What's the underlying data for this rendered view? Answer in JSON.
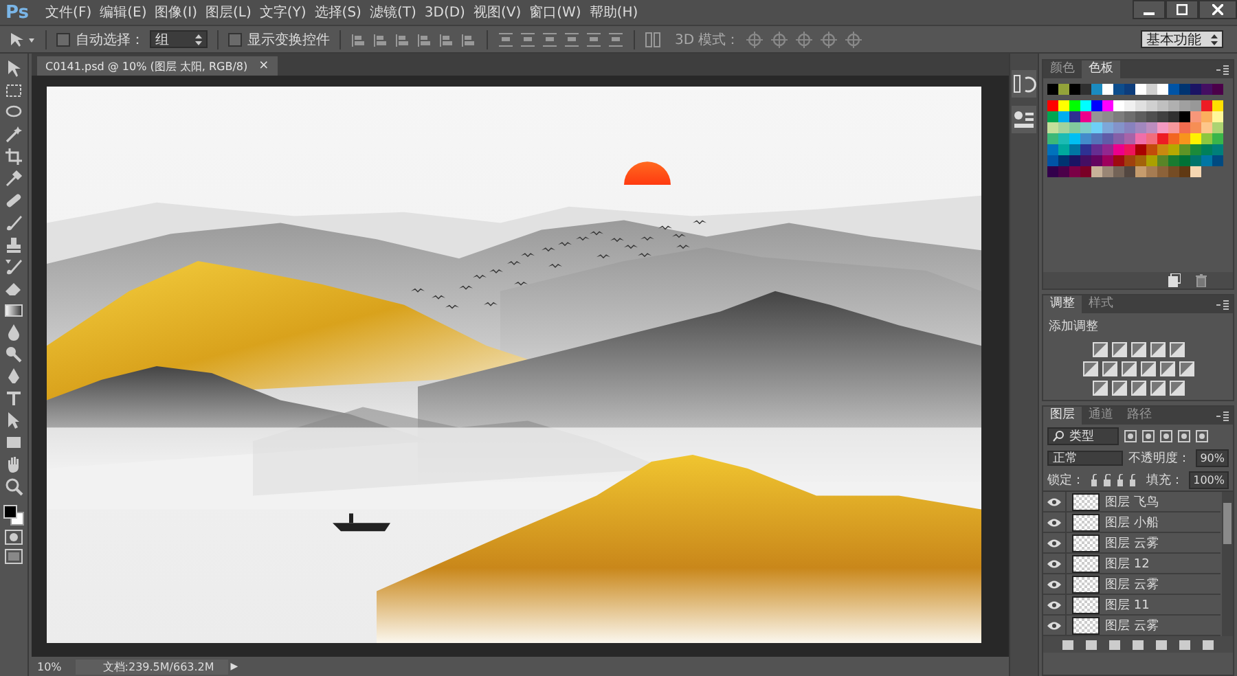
{
  "app_logo": "Ps",
  "menu": [
    "文件(F)",
    "编辑(E)",
    "图像(I)",
    "图层(L)",
    "文字(Y)",
    "选择(S)",
    "滤镜(T)",
    "3D(D)",
    "视图(V)",
    "窗口(W)",
    "帮助(H)"
  ],
  "options_bar": {
    "auto_select": {
      "label": "自动选择：",
      "checked": false
    },
    "auto_select_target": "组",
    "show_transform": {
      "label": "显示变换控件",
      "checked": false
    },
    "mode_3d_label": "3D 模式："
  },
  "workspace": "基本功能",
  "document_tab": {
    "title": "C0141.psd @ 10% (图层 太阳, RGB/8)",
    "close": "×"
  },
  "color_panel": {
    "tabs": [
      {
        "label": "颜色",
        "selected": false
      },
      {
        "label": "色板",
        "selected": true
      }
    ],
    "recent_swatches": [
      {
        "color": "#000000"
      },
      {
        "color": "#93a33a"
      },
      {
        "color": "#000000"
      },
      {
        "color": "#303030"
      },
      {
        "color": "#1b8bc0"
      },
      {
        "color": "#ffffff"
      },
      {
        "color": "#0d4d8c"
      },
      {
        "color": "#0d3d7c"
      },
      {
        "color": "#ffffff"
      },
      {
        "color": "#d0d0d0"
      },
      {
        "color": "#ffffff"
      },
      {
        "color": "#0054a6"
      },
      {
        "color": "#003471"
      },
      {
        "color": "#1b1464"
      },
      {
        "color": "#440e62"
      },
      {
        "color": "#4b0049"
      }
    ],
    "swatches": [
      [
        {
          "color": "#ff0000"
        },
        {
          "color": "#ffff00"
        },
        {
          "color": "#00ff00"
        },
        {
          "color": "#00ffff"
        },
        {
          "color": "#0000ff"
        },
        {
          "color": "#ff00ff"
        },
        {
          "color": "#ffffff"
        },
        {
          "color": "#f0f0f0"
        },
        {
          "color": "#e0e0e0"
        },
        {
          "color": "#d0d0d0"
        },
        {
          "color": "#c0c0c0"
        },
        {
          "color": "#b0b0b0"
        },
        {
          "color": "#a0a0a0"
        },
        {
          "color": "#989898"
        },
        {
          "color": "#ee1c24"
        },
        {
          "color": "#ffe000"
        }
      ],
      [
        {
          "color": "#00a651"
        },
        {
          "color": "#00aeef"
        },
        {
          "color": "#2e3192"
        },
        {
          "color": "#ec008c"
        },
        {
          "color": "#959595"
        },
        {
          "color": "#8c8c8c"
        },
        {
          "color": "#7d7d7d"
        },
        {
          "color": "#6e6e6e"
        },
        {
          "color": "#5e5e5e"
        },
        {
          "color": "#4f4f4f"
        },
        {
          "color": "#404040"
        },
        {
          "color": "#303030"
        },
        {
          "color": "#000000"
        },
        {
          "color": "#f7977a"
        },
        {
          "color": "#fbaf5d"
        },
        {
          "color": "#fff79a"
        }
      ],
      [
        {
          "color": "#c4df9b"
        },
        {
          "color": "#a3d39c"
        },
        {
          "color": "#82ca9d"
        },
        {
          "color": "#7bcdc8"
        },
        {
          "color": "#6ecff6"
        },
        {
          "color": "#7ea7d8"
        },
        {
          "color": "#8493ca"
        },
        {
          "color": "#8882be"
        },
        {
          "color": "#a187be"
        },
        {
          "color": "#bc8dbf"
        },
        {
          "color": "#f49ac2"
        },
        {
          "color": "#f6989d"
        },
        {
          "color": "#f26c4f"
        },
        {
          "color": "#f68e55"
        },
        {
          "color": "#fdc68a"
        },
        {
          "color": "#acd372"
        }
      ],
      [
        {
          "color": "#3cb878"
        },
        {
          "color": "#1cbbb4"
        },
        {
          "color": "#00bff3"
        },
        {
          "color": "#438ccb"
        },
        {
          "color": "#5574b9"
        },
        {
          "color": "#605ca8"
        },
        {
          "color": "#855fa8"
        },
        {
          "color": "#a763a8"
        },
        {
          "color": "#f06ea9"
        },
        {
          "color": "#f26d7d"
        },
        {
          "color": "#ed1c24"
        },
        {
          "color": "#f26522"
        },
        {
          "color": "#f7941d"
        },
        {
          "color": "#fff200"
        },
        {
          "color": "#8dc73f"
        },
        {
          "color": "#39b54a"
        }
      ],
      [
        {
          "color": "#0072bc"
        },
        {
          "color": "#00a99d"
        },
        {
          "color": "#0076a3"
        },
        {
          "color": "#2e3192"
        },
        {
          "color": "#662d91"
        },
        {
          "color": "#92278f"
        },
        {
          "color": "#ec008c"
        },
        {
          "color": "#ed145b"
        },
        {
          "color": "#aa0000"
        },
        {
          "color": "#c24b0a"
        },
        {
          "color": "#c98910"
        },
        {
          "color": "#b5a900"
        },
        {
          "color": "#5e9426"
        },
        {
          "color": "#1b8a3a"
        },
        {
          "color": "#00805a"
        },
        {
          "color": "#007f7a"
        }
      ],
      [
        {
          "color": "#0054a6"
        },
        {
          "color": "#003471"
        },
        {
          "color": "#1b1464"
        },
        {
          "color": "#440e62"
        },
        {
          "color": "#630460"
        },
        {
          "color": "#9e005d"
        },
        {
          "color": "#9e0b0f"
        },
        {
          "color": "#a0410d"
        },
        {
          "color": "#a36209"
        },
        {
          "color": "#aba000"
        },
        {
          "color": "#598527"
        },
        {
          "color": "#197b30"
        },
        {
          "color": "#007236"
        },
        {
          "color": "#00746b"
        },
        {
          "color": "#0076a3"
        },
        {
          "color": "#004a80"
        }
      ],
      [
        {
          "color": "#32004b"
        },
        {
          "color": "#4b0049"
        },
        {
          "color": "#7b0046"
        },
        {
          "color": "#7a0026"
        },
        {
          "color": "#c7b299"
        },
        {
          "color": "#998675"
        },
        {
          "color": "#736357"
        },
        {
          "color": "#534741"
        },
        {
          "color": "#c69c6d"
        },
        {
          "color": "#a67c52"
        },
        {
          "color": "#8c6239"
        },
        {
          "color": "#754c24"
        },
        {
          "color": "#603913"
        },
        {
          "color": "#f5d7b2"
        }
      ]
    ]
  },
  "adjustments_panel": {
    "tabs": [
      {
        "label": "调整",
        "selected": true
      },
      {
        "label": "样式",
        "selected": false
      }
    ],
    "heading": "添加调整"
  },
  "layers_panel": {
    "tabs": [
      {
        "label": "图层",
        "selected": true
      },
      {
        "label": "通道",
        "selected": false
      },
      {
        "label": "路径",
        "selected": false
      }
    ],
    "filter": "类型",
    "blend_mode": "正常",
    "opacity_label": "不透明度：",
    "opacity": "90%",
    "lock_label": "锁定：",
    "fill_label": "填充：",
    "fill": "100%",
    "layers": [
      {
        "name": "图层 飞鸟",
        "visible": true
      },
      {
        "name": "图层 小船",
        "visible": true
      },
      {
        "name": "图层 云雾",
        "visible": true
      },
      {
        "name": "图层 12",
        "visible": true
      },
      {
        "name": "图层 云雾",
        "visible": true
      },
      {
        "name": "图层 11",
        "visible": true
      },
      {
        "name": "图层 云雾",
        "visible": true
      }
    ]
  },
  "status_bar": {
    "zoom": "10%",
    "doc_info": "文档:239.5M/663.2M",
    "menu_arrow": "▶"
  }
}
